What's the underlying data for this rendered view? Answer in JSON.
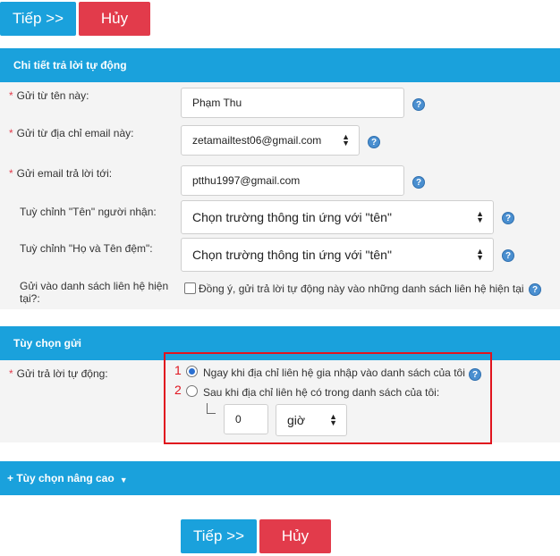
{
  "top_buttons": {
    "next": "Tiếp >>",
    "cancel": "Hủy"
  },
  "section_details": {
    "title": "Chi tiết trả lời tự động",
    "from_name": {
      "label": "Gửi từ tên này:",
      "value": "Phạm Thu"
    },
    "from_email": {
      "label": "Gửi từ địa chỉ email này:",
      "value": "zetamailtest06@gmail.com"
    },
    "reply_to": {
      "label": "Gửi email trả lời tới:",
      "value": "ptthu1997@gmail.com"
    },
    "custom_name": {
      "label": "Tuỳ chỉnh \"Tên\" người nhận:",
      "value": "Chọn trường thông tin ứng với \"tên\""
    },
    "custom_fullname": {
      "label": "Tuỳ chỉnh \"Họ và Tên đệm\":",
      "value": "Chọn trường thông tin ứng với \"tên\""
    },
    "existing_lists": {
      "label": "Gửi vào danh sách liên hệ hiện tại?:",
      "checkbox_text": "Đồng ý, gửi trả lời tự động này vào những danh sách liên hệ hiện tại"
    }
  },
  "section_send": {
    "title": "Tùy chọn gửi",
    "label": "Gửi trả lời tự động:",
    "option1": {
      "marker": "1",
      "text": "Ngay khi địa chỉ liên hệ gia nhập vào danh sách của tôi"
    },
    "option2": {
      "marker": "2",
      "text": "Sau khi địa chỉ liên hệ có trong danh sách của tôi:"
    },
    "delay_value": "0",
    "delay_unit": "giờ"
  },
  "section_advanced": {
    "title": "+ Tùy chọn nâng cao"
  },
  "bottom_buttons": {
    "next": "Tiếp >>",
    "cancel": "Hủy"
  },
  "colors": {
    "accent": "#1aa1dc",
    "danger": "#e23b4b",
    "highlight_box": "#e0141e"
  },
  "icons": {
    "help": "help-icon",
    "caret": "select-caret-icon",
    "dropdown": "chevron-down-icon"
  }
}
